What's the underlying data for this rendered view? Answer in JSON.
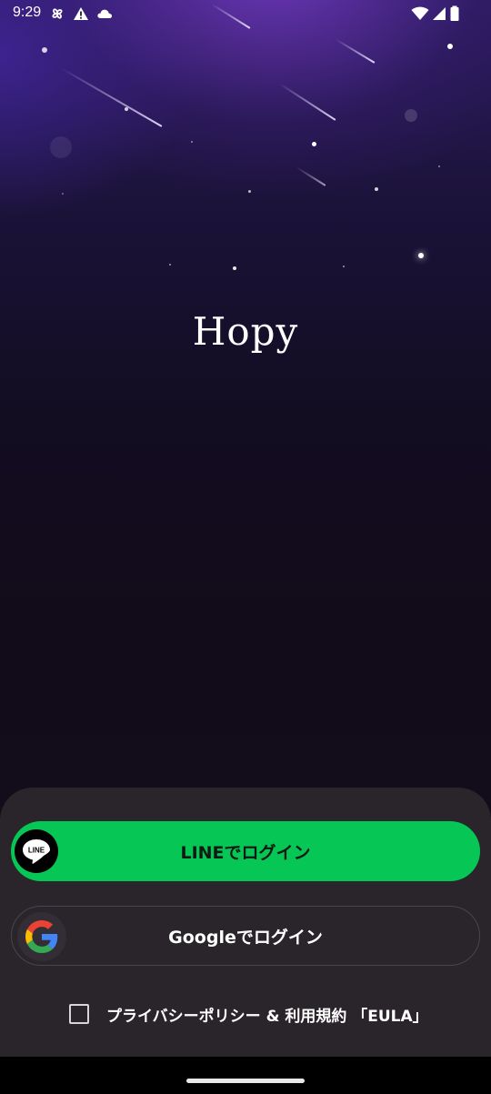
{
  "status_bar": {
    "time": "9:29",
    "left_icons": [
      "pinwheel-icon",
      "warning-icon",
      "cloud-icon"
    ],
    "right_icons": [
      "wifi-icon",
      "signal-icon",
      "battery-icon"
    ]
  },
  "app": {
    "title": "Hopy"
  },
  "login": {
    "line_label": "LINEでログイン",
    "line_logo_text": "LINE",
    "google_label": "Googleでログイン"
  },
  "consent": {
    "label": "プライバシーポリシー & 利用規約 「EULA」",
    "checked": false
  },
  "colors": {
    "line_green": "#06c755",
    "sheet_bg": "#2a252b",
    "google_blue": "#4285F4",
    "google_red": "#EA4335",
    "google_yellow": "#FBBC05",
    "google_green": "#34A853"
  }
}
